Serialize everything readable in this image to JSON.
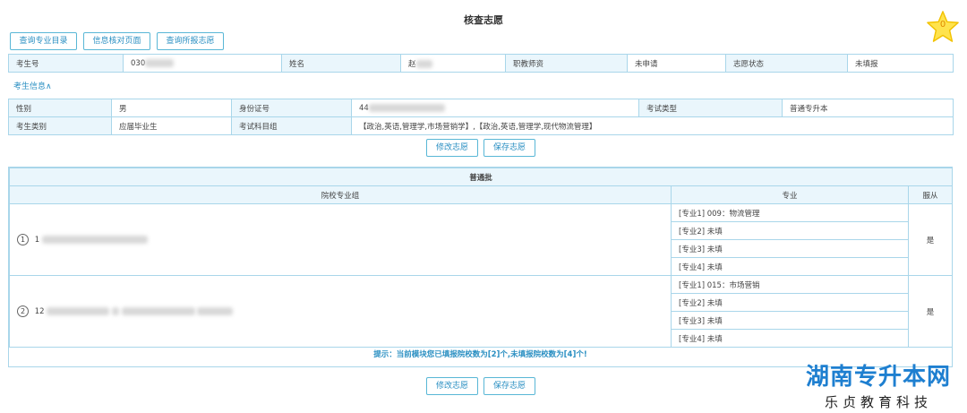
{
  "page": {
    "title": "核查志愿"
  },
  "star": {
    "count": "0"
  },
  "toolbar": {
    "btn_major_catalog": "查询专业目录",
    "btn_info_check": "信息核对页面",
    "btn_query_wishes": "查询所报志愿"
  },
  "info1": {
    "exam_no_label": "考生号",
    "exam_no_value": "030",
    "name_label": "姓名",
    "name_value": "赵",
    "qualification_label": "职教师资",
    "qualification_value": "未申请",
    "status_label": "志愿状态",
    "status_value": "未填报"
  },
  "toggle": {
    "label": "考生信息∧"
  },
  "info2": {
    "gender_label": "性别",
    "gender_value": "男",
    "id_label": "身份证号",
    "id_value": "44",
    "exam_type_label": "考试类型",
    "exam_type_value": "普通专升本",
    "category_label": "考生类别",
    "category_value": "应届毕业生",
    "subjects_label": "考试科目组",
    "subjects_value": "【政治,英语,管理学,市场营销学】,【政治,英语,管理学,现代物流管理】"
  },
  "actions": {
    "modify": "修改志愿",
    "save": "保存志愿"
  },
  "batch": {
    "title": "普通批",
    "col_group": "院校专业组",
    "col_major": "专业",
    "col_obey": "服从",
    "groups": [
      {
        "no": "1",
        "code": "1",
        "majors": [
          "[专业1] 009：物流管理",
          "[专业2] 未填",
          "[专业3] 未填",
          "[专业4] 未填"
        ],
        "obey": "是"
      },
      {
        "no": "2",
        "code": "12",
        "majors": [
          "[专业1] 015：市场营销",
          "[专业2] 未填",
          "[专业3] 未填",
          "[专业4] 未填"
        ],
        "obey": "是"
      }
    ],
    "hint": "提示：当前模块您已填报院校数为[2]个,未填报院校数为[4]个!"
  },
  "brand": {
    "name": "湖南专升本网",
    "sub": "乐贞教育科技"
  }
}
